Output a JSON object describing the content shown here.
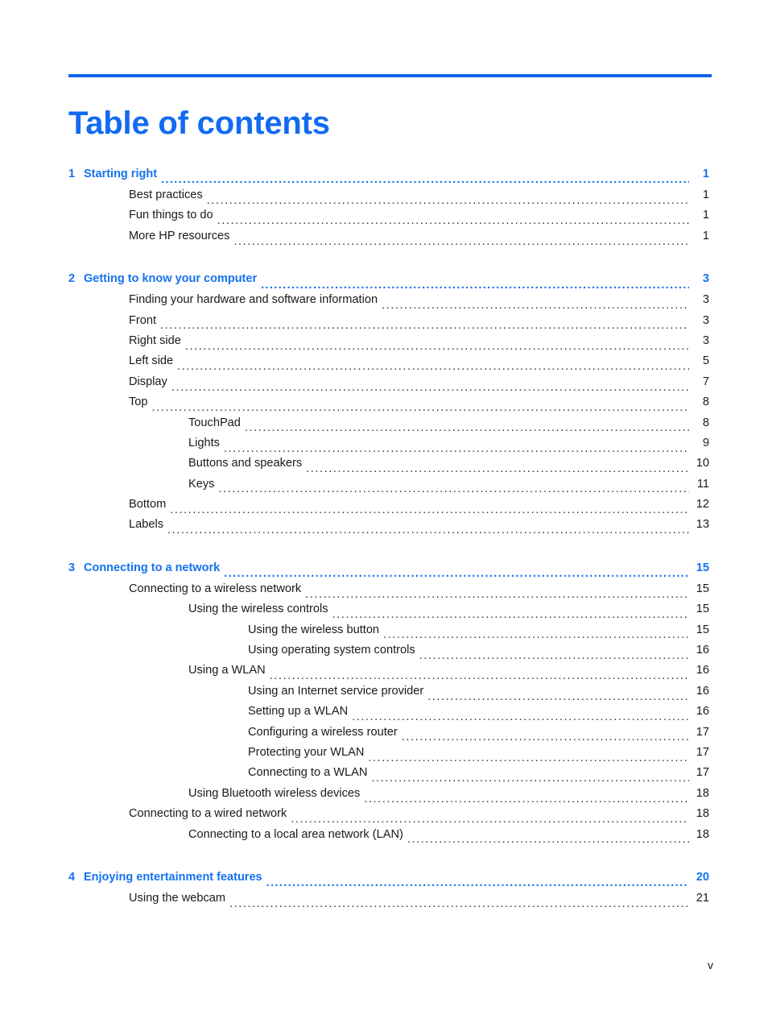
{
  "document": {
    "title": "Table of contents",
    "accent_color": "#126bf0",
    "rule_color": "#0d64e8",
    "footer_page_number": "v"
  },
  "toc": {
    "groups": [
      {
        "chapter": {
          "number": "1",
          "label": "Starting right",
          "page": "1",
          "level": 0
        },
        "entries": [
          {
            "label": "Best practices",
            "page": "1",
            "level": 1
          },
          {
            "label": "Fun things to do",
            "page": "1",
            "level": 1
          },
          {
            "label": "More HP resources",
            "page": "1",
            "level": 1
          }
        ]
      },
      {
        "chapter": {
          "number": "2",
          "label": "Getting to know your computer",
          "page": "3",
          "level": 0
        },
        "entries": [
          {
            "label": "Finding your hardware and software information",
            "page": "3",
            "level": 1
          },
          {
            "label": "Front",
            "page": "3",
            "level": 1
          },
          {
            "label": "Right side",
            "page": "3",
            "level": 1
          },
          {
            "label": "Left side",
            "page": "5",
            "level": 1
          },
          {
            "label": "Display",
            "page": "7",
            "level": 1
          },
          {
            "label": "Top",
            "page": "8",
            "level": 1
          },
          {
            "label": "TouchPad",
            "page": "8",
            "level": 2
          },
          {
            "label": "Lights",
            "page": "9",
            "level": 2
          },
          {
            "label": "Buttons and speakers",
            "page": "10",
            "level": 2
          },
          {
            "label": "Keys",
            "page": "11",
            "level": 2
          },
          {
            "label": "Bottom",
            "page": "12",
            "level": 1
          },
          {
            "label": "Labels",
            "page": "13",
            "level": 1
          }
        ]
      },
      {
        "chapter": {
          "number": "3",
          "label": "Connecting to a network",
          "page": "15",
          "level": 0
        },
        "entries": [
          {
            "label": "Connecting to a wireless network",
            "page": "15",
            "level": 1
          },
          {
            "label": "Using the wireless controls",
            "page": "15",
            "level": 2
          },
          {
            "label": "Using the wireless button",
            "page": "15",
            "level": 3
          },
          {
            "label": "Using operating system controls",
            "page": "16",
            "level": 3
          },
          {
            "label": "Using a WLAN",
            "page": "16",
            "level": 2
          },
          {
            "label": "Using an Internet service provider",
            "page": "16",
            "level": 3
          },
          {
            "label": "Setting up a WLAN",
            "page": "16",
            "level": 3
          },
          {
            "label": "Configuring a wireless router",
            "page": "17",
            "level": 3
          },
          {
            "label": "Protecting your WLAN",
            "page": "17",
            "level": 3
          },
          {
            "label": "Connecting to a WLAN",
            "page": "17",
            "level": 3
          },
          {
            "label": "Using Bluetooth wireless devices",
            "page": "18",
            "level": 2
          },
          {
            "label": "Connecting to a wired network",
            "page": "18",
            "level": 1
          },
          {
            "label": "Connecting to a local area network (LAN)",
            "page": "18",
            "level": 2
          }
        ]
      },
      {
        "chapter": {
          "number": "4",
          "label": "Enjoying entertainment features",
          "page": "20",
          "level": 0
        },
        "entries": [
          {
            "label": "Using the webcam",
            "page": "21",
            "level": 1
          }
        ]
      }
    ]
  }
}
